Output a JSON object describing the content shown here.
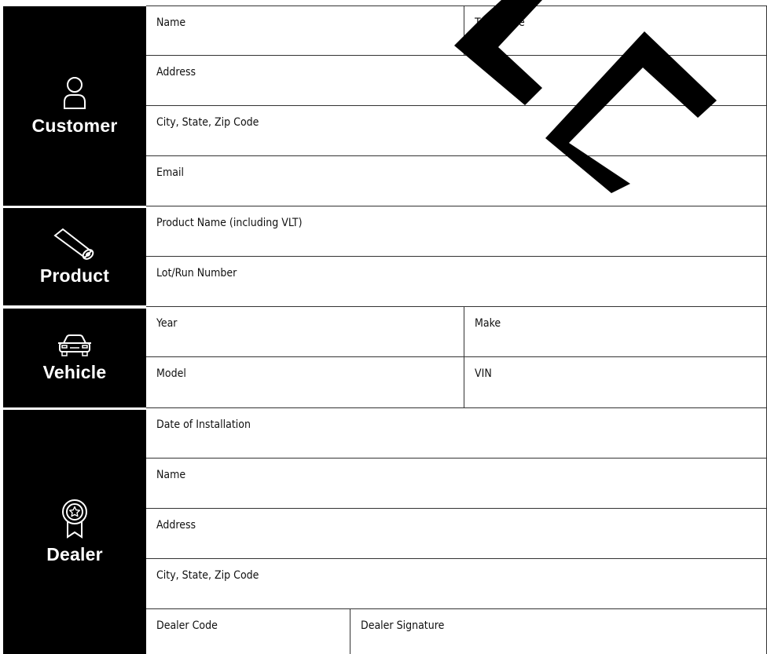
{
  "sections": {
    "customer": {
      "title": "Customer",
      "icon": "person-icon",
      "fields": {
        "name": "Name",
        "phone": "Telephone",
        "address": "Address",
        "city": "City, State, Zip Code",
        "email": "Email"
      }
    },
    "product": {
      "title": "Product",
      "icon": "film-roll-icon",
      "fields": {
        "product_name": "Product Name (including VLT)",
        "lot": "Lot/Run Number"
      }
    },
    "vehicle": {
      "title": "Vehicle",
      "icon": "car-icon",
      "fields": {
        "year": "Year",
        "make": "Make",
        "model": "Model",
        "vin": "VIN"
      }
    },
    "dealer": {
      "title": "Dealer",
      "icon": "award-ribbon-icon",
      "fields": {
        "date": "Date of Installation",
        "name": "Name",
        "address": "Address",
        "city": "City, State, Zip Code",
        "code": "Dealer Code",
        "signature": "Dealer Signature"
      }
    }
  },
  "watermark": {
    "icon": "watermark-logo-icon",
    "color": "#000000"
  }
}
